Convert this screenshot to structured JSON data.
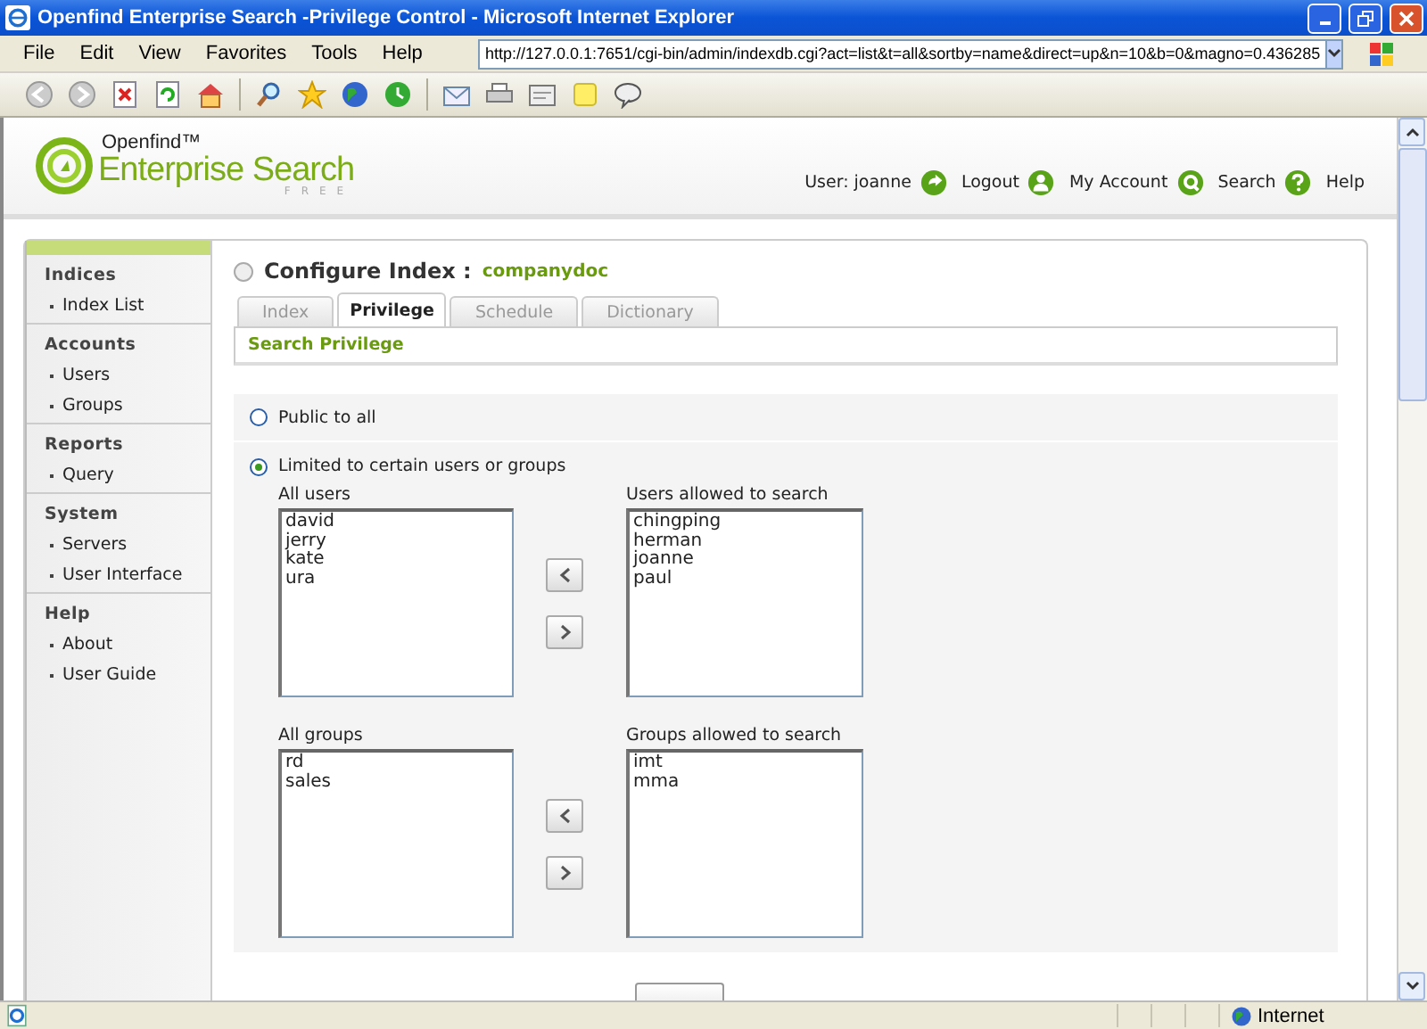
{
  "window": {
    "title": "Openfind Enterprise Search -Privilege Control - Microsoft Internet Explorer",
    "menu": [
      "File",
      "Edit",
      "View",
      "Favorites",
      "Tools",
      "Help"
    ],
    "address": "http://127.0.0.1:7651/cgi-bin/admin/indexdb.cgi?act=list&t=all&sortby=name&direct=up&n=10&b=0&magno=0.436285",
    "status_zone": "Internet"
  },
  "header": {
    "brand": "Openfind™",
    "product": "Enterprise Search",
    "edition": "FREE",
    "user_label": "User: joanne",
    "links": [
      {
        "kind": "logout",
        "label": "Logout"
      },
      {
        "kind": "account",
        "label": "My Account"
      },
      {
        "kind": "search",
        "label": "Search"
      },
      {
        "kind": "help",
        "label": "Help"
      }
    ]
  },
  "sidebar": {
    "sections": [
      {
        "title": "Indices",
        "items": [
          "Index List"
        ]
      },
      {
        "title": "Accounts",
        "items": [
          "Users",
          "Groups"
        ]
      },
      {
        "title": "Reports",
        "items": [
          "Query"
        ]
      },
      {
        "title": "System",
        "items": [
          "Servers",
          "User Interface"
        ]
      },
      {
        "title": "Help",
        "items": [
          "About",
          "User Guide"
        ]
      }
    ]
  },
  "page": {
    "heading": "Configure Index :",
    "index_name": "companydoc",
    "tabs": [
      {
        "label": "Index",
        "selected": false
      },
      {
        "label": "Privilege",
        "selected": true
      },
      {
        "label": "Schedule",
        "selected": false
      },
      {
        "label": "Dictionary",
        "selected": false
      }
    ],
    "section_title": "Search Privilege",
    "options": [
      {
        "label": "Public to all",
        "selected": false
      },
      {
        "label": "Limited to certain users or groups",
        "selected": true
      }
    ],
    "lists": [
      {
        "available_label": "All users",
        "available": [
          "david",
          "jerry",
          "kate",
          "ura"
        ],
        "allowed_label": "Users allowed to search",
        "allowed": [
          "chingping",
          "herman",
          "joanne",
          "paul"
        ]
      },
      {
        "available_label": "All groups",
        "available": [
          "rd",
          "sales"
        ],
        "allowed_label": "Groups allowed to search",
        "allowed": [
          "imt",
          "mma"
        ]
      }
    ]
  }
}
